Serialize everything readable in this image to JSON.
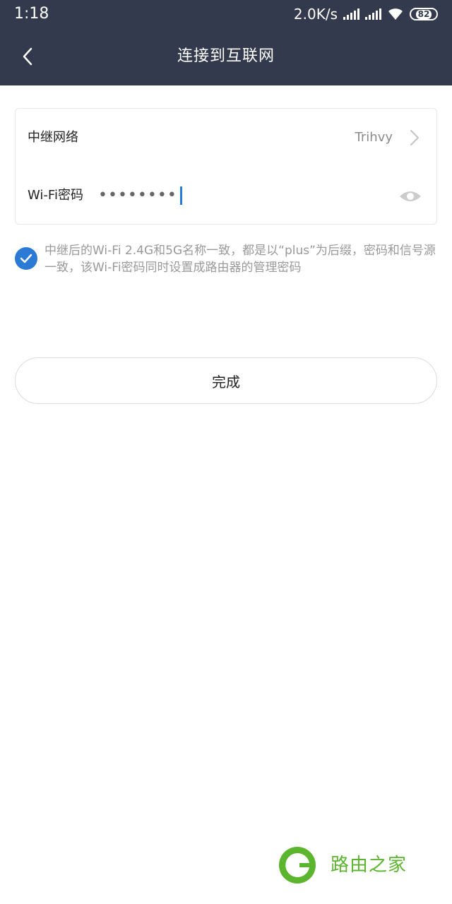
{
  "status_bar": {
    "time": "1:18",
    "net_speed": "2.0K/s",
    "battery": "82"
  },
  "nav": {
    "back_icon": "chevron-left-icon",
    "title": "连接到互联网"
  },
  "form": {
    "relay_network": {
      "label": "中继网络",
      "value": "Trihvy",
      "icon": "chevron-right-icon"
    },
    "wifi_password": {
      "label": "Wi-Fi密码",
      "masked_value": "••••••••",
      "visibility_icon": "eye-icon"
    }
  },
  "note": {
    "checked": true,
    "text": "中继后的Wi-Fi 2.4G和5G名称一致，都是以“plus”为后缀，密码和信号源一致，该Wi-Fi密码同时设置成路由器的管理密码"
  },
  "done_button": {
    "label": "完成"
  },
  "watermark": {
    "text": "路由之家"
  },
  "colors": {
    "header_bg": "#333a4d",
    "accent_blue": "#2b7bd6",
    "watermark_green": "#5cb52e"
  }
}
